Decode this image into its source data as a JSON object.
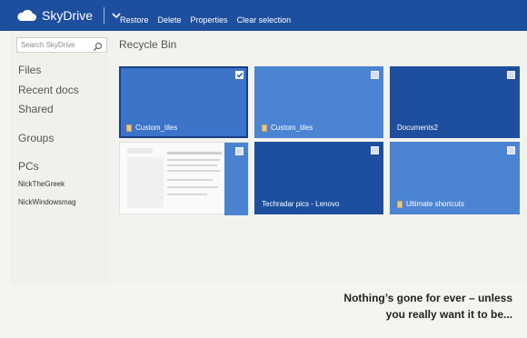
{
  "topbar": {
    "brand": "SkyDrive",
    "actions": [
      "Restore",
      "Delete",
      "Properties",
      "Clear selection"
    ]
  },
  "sidebar": {
    "search_placeholder": "Search SkyDrive",
    "items": [
      "Files",
      "Recent docs",
      "Shared",
      "Groups",
      "PCs"
    ],
    "pcs": [
      "NickTheGreek",
      "NickWindowsmag"
    ]
  },
  "main": {
    "title": "Recycle Bin",
    "tiles": [
      {
        "label": "Custom_tiles",
        "selected": true
      },
      {
        "label": "Custom_tiles",
        "selected": false
      },
      {
        "label": "Documents2",
        "selected": false
      },
      {
        "label": "",
        "selected": false
      },
      {
        "label": "Techradar pics - Lenovo",
        "selected": false
      },
      {
        "label": "Ultimate shortcuts",
        "selected": false
      }
    ]
  },
  "caption": {
    "line1": "Nothing’s gone for ever – unless",
    "line2": "you really want it to be..."
  },
  "colors": {
    "topbar": "#1e4f9e",
    "tile_selected": "#3b74c9",
    "tile_light": "#4a84d2",
    "tile_dark": "#1e4f9e"
  }
}
